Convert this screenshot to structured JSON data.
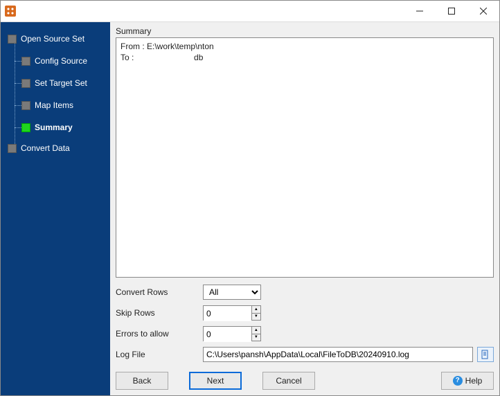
{
  "window": {
    "title": ""
  },
  "sidebar": {
    "root": {
      "label": "Open Source Set"
    },
    "children": [
      {
        "label": "Config Source",
        "active": false
      },
      {
        "label": "Set Target Set",
        "active": false
      },
      {
        "label": "Map Items",
        "active": false
      },
      {
        "label": "Summary",
        "active": true
      }
    ],
    "root2": {
      "label": "Convert Data"
    }
  },
  "summary": {
    "label": "Summary",
    "text": "From : E:\\work\\temp\\nton\nTo :                          db"
  },
  "form": {
    "convert_rows": {
      "label": "Convert Rows",
      "value": "All",
      "options": [
        "All"
      ]
    },
    "skip_rows": {
      "label": "Skip Rows",
      "value": "0"
    },
    "errors_to_allow": {
      "label": "Errors to allow",
      "value": "0"
    },
    "log_file": {
      "label": "Log File",
      "value": "C:\\Users\\pansh\\AppData\\Local\\FileToDB\\20240910.log"
    }
  },
  "buttons": {
    "back": "Back",
    "next": "Next",
    "cancel": "Cancel",
    "help": "Help"
  }
}
